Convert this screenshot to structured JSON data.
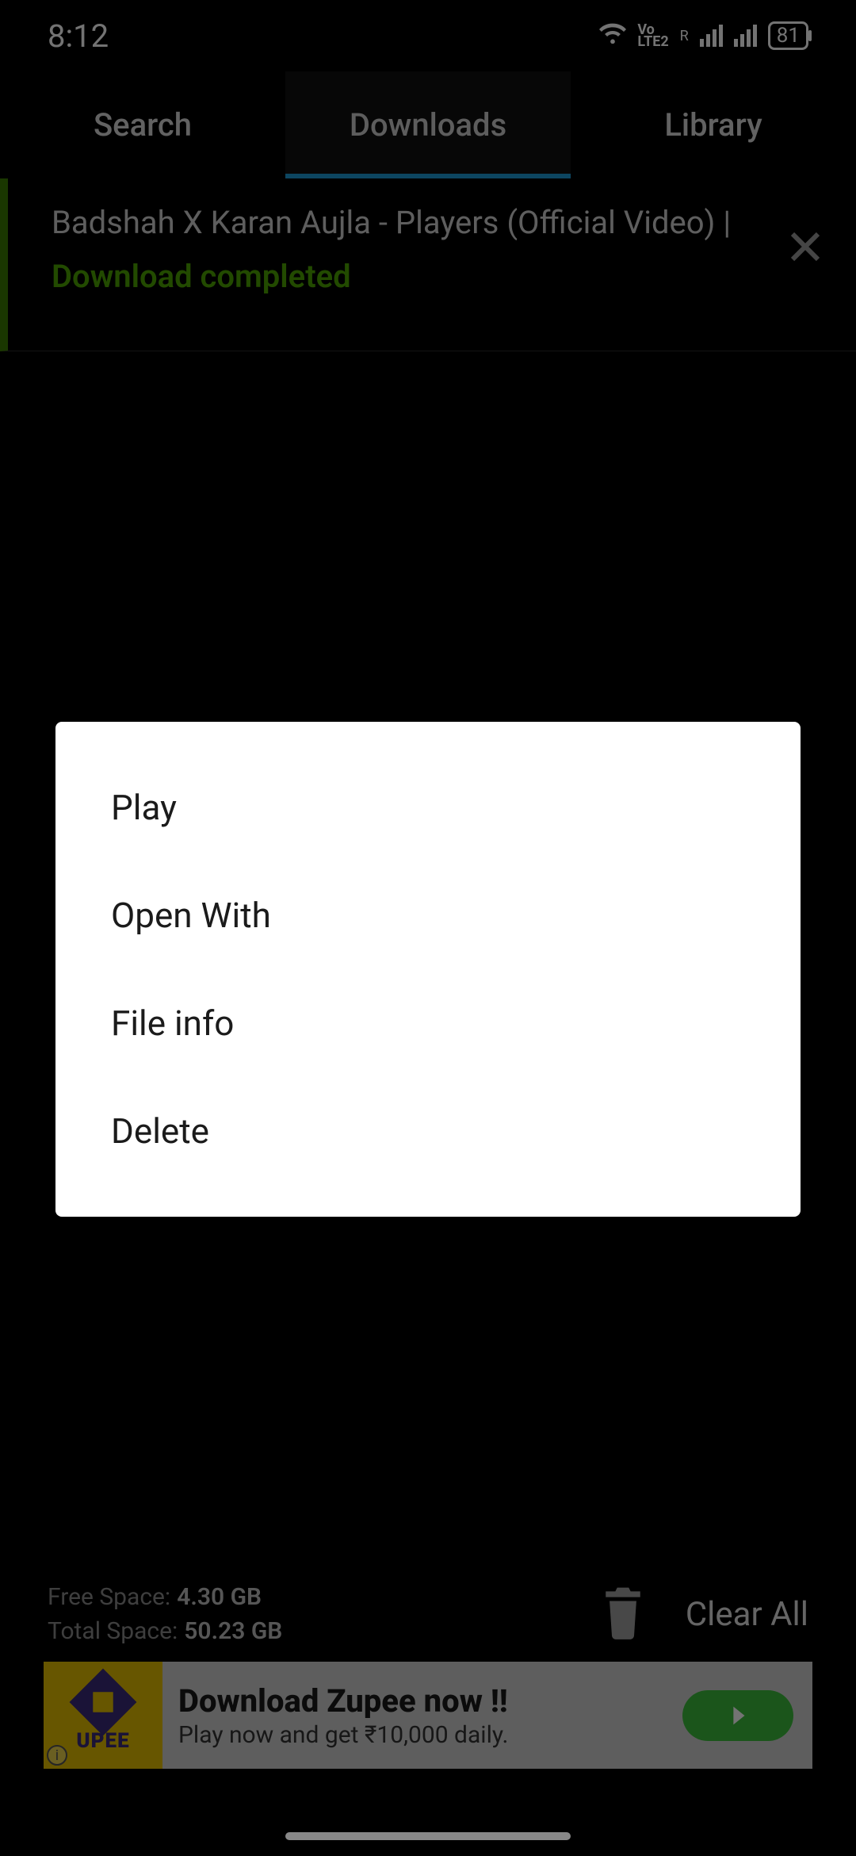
{
  "status": {
    "time": "8:12",
    "battery": "81",
    "volte": "Vo\nLTE2",
    "r": "R"
  },
  "tabs": {
    "search": "Search",
    "downloads": "Downloads",
    "library": "Library"
  },
  "download_item": {
    "title": "Badshah X Karan Aujla - Players (Official Video) |",
    "status": "Download completed"
  },
  "menu": {
    "play": "Play",
    "open_with": "Open With",
    "file_info": "File info",
    "delete": "Delete"
  },
  "storage": {
    "free_label": "Free Space:",
    "free_value": "4.30 GB",
    "total_label": "Total Space:",
    "total_value": "50.23 GB"
  },
  "clear_all": "Clear All",
  "ad": {
    "brand": "UPEE",
    "headline": "Download Zupee now !!",
    "sub": "Play now and get ₹10,000 daily."
  }
}
